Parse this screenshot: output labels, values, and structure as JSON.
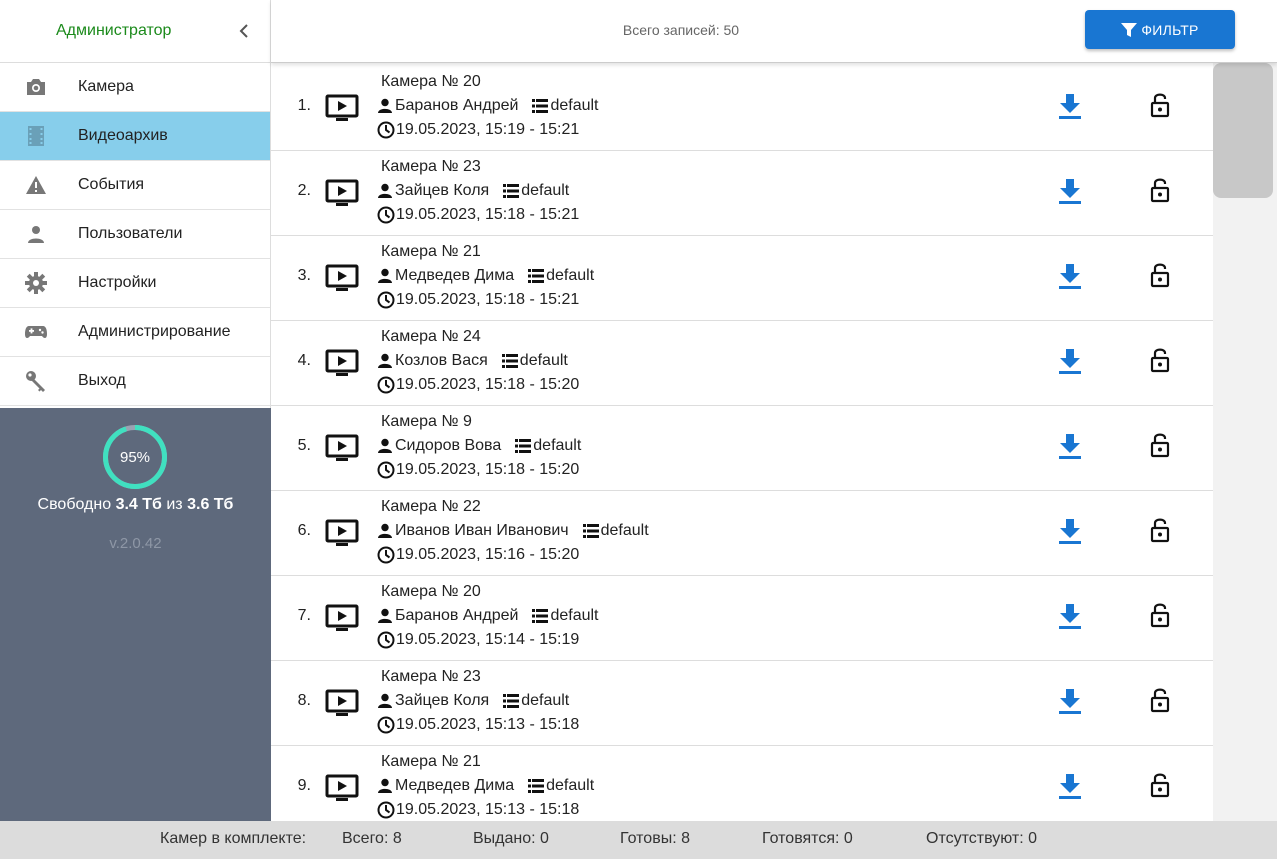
{
  "sidebar": {
    "title": "Администратор",
    "menu": [
      {
        "label": "Камера",
        "icon": "camera-icon"
      },
      {
        "label": "Видеоархив",
        "icon": "film-icon"
      },
      {
        "label": "События",
        "icon": "warning-icon"
      },
      {
        "label": "Пользователи",
        "icon": "person-icon"
      },
      {
        "label": "Настройки",
        "icon": "gear-icon"
      },
      {
        "label": "Администрирование",
        "icon": "gamepad-icon"
      },
      {
        "label": "Выход",
        "icon": "key-icon"
      }
    ],
    "active_item": "Видеоархив",
    "storage": {
      "percent_label": "95%",
      "percent": 95,
      "free_prefix": "Свободно",
      "free_value": "3.4 Тб",
      "of_word": "из",
      "total_value": "3.6 Тб"
    },
    "version": "v.2.0.42"
  },
  "topbar": {
    "total": "Всего записей: 50",
    "filter_label": "ФИЛЬТР"
  },
  "records": [
    {
      "num": "1.",
      "camera": "Камера № 20",
      "user": "Баранов Андрей",
      "group": "default",
      "time": "19.05.2023, 15:19 - 15:21"
    },
    {
      "num": "2.",
      "camera": "Камера № 23",
      "user": "Зайцев Коля",
      "group": "default",
      "time": "19.05.2023, 15:18 - 15:21"
    },
    {
      "num": "3.",
      "camera": "Камера № 21",
      "user": "Медведев Дима",
      "group": "default",
      "time": "19.05.2023, 15:18 - 15:21"
    },
    {
      "num": "4.",
      "camera": "Камера № 24",
      "user": "Козлов Вася",
      "group": "default",
      "time": "19.05.2023, 15:18 - 15:20"
    },
    {
      "num": "5.",
      "camera": "Камера № 9",
      "user": "Сидоров Вова",
      "group": "default",
      "time": "19.05.2023, 15:18 - 15:20"
    },
    {
      "num": "6.",
      "camera": "Камера № 22",
      "user": "Иванов Иван Иванович",
      "group": "default",
      "time": "19.05.2023, 15:16 - 15:20"
    },
    {
      "num": "7.",
      "camera": "Камера № 20",
      "user": "Баранов Андрей",
      "group": "default",
      "time": "19.05.2023, 15:14 - 15:19"
    },
    {
      "num": "8.",
      "camera": "Камера № 23",
      "user": "Зайцев Коля",
      "group": "default",
      "time": "19.05.2023, 15:13 - 15:18"
    },
    {
      "num": "9.",
      "camera": "Камера № 21",
      "user": "Медведев Дима",
      "group": "default",
      "time": "19.05.2023, 15:13 - 15:18"
    }
  ],
  "footer": {
    "label": "Камер в комплекте:",
    "total": "Всего: 8",
    "issued": "Выдано: 0",
    "ready": "Готовы: 8",
    "preparing": "Готовятся: 0",
    "absent": "Отсутствуют: 0"
  },
  "colors": {
    "accent": "#1976d2",
    "active_menu": "#87ceeb",
    "admin_title": "#1b8a1b",
    "storage_panel": "#5e697c",
    "gauge_ring": "#40e0c0"
  }
}
